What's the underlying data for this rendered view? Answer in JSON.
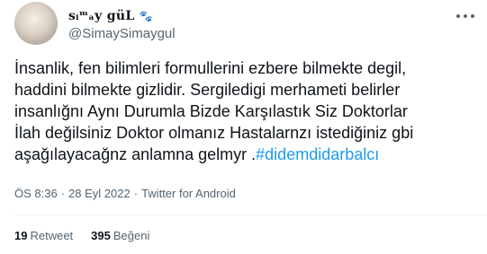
{
  "author": {
    "display_name": "sᵢᵐₐy güL",
    "badge_icon": "paw-print-icon",
    "handle": "@SimaySimaygul"
  },
  "tweet": {
    "text": "İnsanlik, fen bilimleri formullerini ezbere bilmekte degil,\nhaddini bilmekte gizlidir. Sergiledigi merhameti belirler\ninsanlığnı Aynı Durumla Bizde Karşılastık Siz Doktorlar\nİlah değilsiniz Doktor olmanız Hastalarnzı istediğiniz gbi\naşağılayacağnz anlamna gelmyr .",
    "hashtag": "#didemdidarbalcı",
    "time": "ÖS 8:36",
    "date": "28 Eyl 2022",
    "source": "Twitter for Android"
  },
  "stats": {
    "retweets_count": "19",
    "retweets_label": "Retweet",
    "likes_count": "395",
    "likes_label": "Beğeni"
  },
  "colors": {
    "accent": "#1d9bf0",
    "secondary_text": "#536471",
    "divider": "#eff3f4"
  }
}
